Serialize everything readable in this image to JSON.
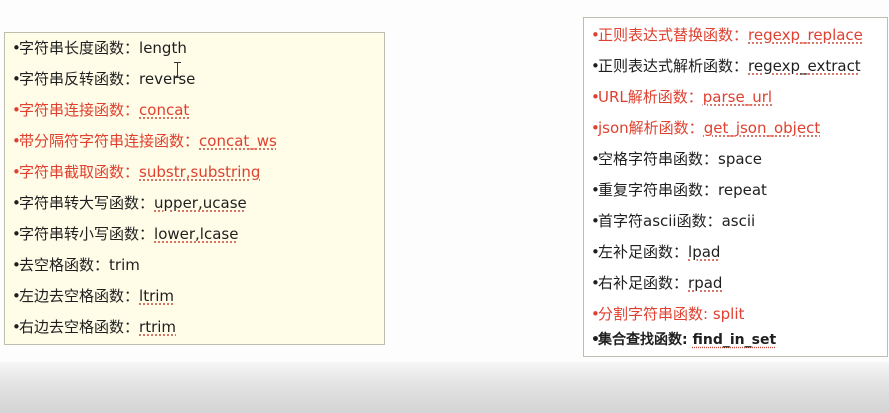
{
  "colors": {
    "accent_red": "#e0402f",
    "text": "#1f1f1f",
    "left_panel_bg": "#fffce8",
    "right_panel_bg": "#ffffff"
  },
  "left_panel": {
    "items": [
      {
        "bullet": "•",
        "label": "字符串长度函数",
        "sep": "：",
        "fn": "length",
        "color": "#1f1f1f",
        "underlined": false
      },
      {
        "bullet": "•",
        "label": "字符串反转函数",
        "sep": "：",
        "fn": "reverse",
        "color": "#1f1f1f",
        "underlined": false
      },
      {
        "bullet": "•",
        "label": "字符串连接函数",
        "sep": "：",
        "fn": "concat",
        "color": "#e0402f",
        "underlined": true
      },
      {
        "bullet": "•",
        "label": "带分隔符字符串连接函数",
        "sep": "：",
        "fn": "concat_ws",
        "color": "#e0402f",
        "underlined": true
      },
      {
        "bullet": "•",
        "label": "字符串截取函数",
        "sep": "：",
        "fn": "substr,substring",
        "color": "#e0402f",
        "underlined": true
      },
      {
        "bullet": "•",
        "label": "字符串转大写函数",
        "sep": "：",
        "fn": "upper,ucase",
        "color": "#1f1f1f",
        "underlined": true
      },
      {
        "bullet": "•",
        "label": "字符串转小写函数",
        "sep": "：",
        "fn": "lower,lcase",
        "color": "#1f1f1f",
        "underlined": true
      },
      {
        "bullet": "•",
        "label": "去空格函数",
        "sep": "：",
        "fn": "trim",
        "color": "#1f1f1f",
        "underlined": false
      },
      {
        "bullet": "•",
        "label": "左边去空格函数",
        "sep": "：",
        "fn": "ltrim",
        "color": "#1f1f1f",
        "underlined": true
      },
      {
        "bullet": "•",
        "label": "右边去空格函数",
        "sep": "：",
        "fn": "rtrim",
        "color": "#1f1f1f",
        "underlined": true
      }
    ]
  },
  "right_panel": {
    "items": [
      {
        "bullet": "•",
        "label": "正则表达式替换函数",
        "sep": "：",
        "fn": "regexp_replace",
        "color": "#e0402f",
        "underlined": true
      },
      {
        "bullet": "•",
        "label": "正则表达式解析函数",
        "sep": "：",
        "fn": "regexp_extract",
        "color": "#1f1f1f",
        "underlined": true
      },
      {
        "bullet": "•",
        "label": "URL解析函数",
        "sep": "：",
        "fn": "parse_url",
        "color": "#e0402f",
        "underlined": true
      },
      {
        "bullet": "•",
        "label": "json解析函数",
        "sep": "：",
        "fn": "get_json_object",
        "color": "#e0402f",
        "underlined": true
      },
      {
        "bullet": "•",
        "label": "空格字符串函数",
        "sep": "：",
        "fn": "space",
        "color": "#1f1f1f",
        "underlined": false
      },
      {
        "bullet": "•",
        "label": "重复字符串函数",
        "sep": "：",
        "fn": "repeat",
        "color": "#1f1f1f",
        "underlined": false
      },
      {
        "bullet": "•",
        "label": "首字符ascii函数",
        "sep": "：",
        "fn": "ascii",
        "color": "#1f1f1f",
        "underlined": false
      },
      {
        "bullet": "•",
        "label": "左补足函数",
        "sep": "：",
        "fn": "lpad",
        "color": "#1f1f1f",
        "underlined": true
      },
      {
        "bullet": "•",
        "label": "右补足函数",
        "sep": "：",
        "fn": "rpad",
        "color": "#1f1f1f",
        "underlined": true
      },
      {
        "bullet": "•",
        "label": "分割字符串函数",
        "sep": ": ",
        "fn": "split",
        "color": "#e0402f",
        "underlined": false
      },
      {
        "bullet": "•",
        "label": "集合查找函数",
        "sep": ": ",
        "fn": "find_in_set",
        "color": "#1f1f1f",
        "underlined": true
      }
    ]
  },
  "cursor": {
    "icon": "text-cursor-icon"
  }
}
